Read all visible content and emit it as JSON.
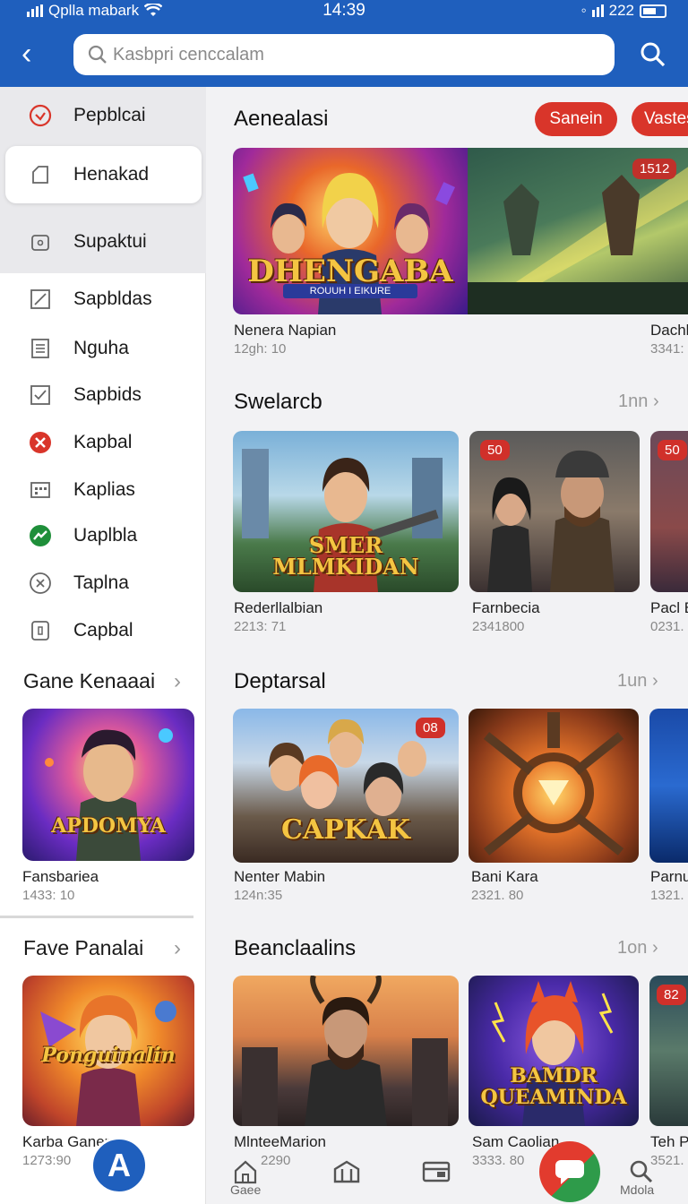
{
  "status": {
    "carrier": "Qplla mabark",
    "time": "14:39",
    "battery": "222"
  },
  "header": {
    "search_placeholder": "Kasbpri cenccalam"
  },
  "sidebar": {
    "top_items": [
      {
        "label": "Pepblcai",
        "icon": "check-circle-icon"
      },
      {
        "label": "Henakad",
        "icon": "cube-icon"
      },
      {
        "label": "Supaktui",
        "icon": "box-icon"
      }
    ],
    "items": [
      {
        "label": "Sapbldas",
        "icon": "slash-square-icon"
      },
      {
        "label": "Nguha",
        "icon": "list-icon"
      },
      {
        "label": "Sapbids",
        "icon": "check-square-icon"
      },
      {
        "label": "Kapbal",
        "icon": "red-x-icon"
      },
      {
        "label": "Kaplias",
        "icon": "grid-icon"
      },
      {
        "label": "Uaplbla",
        "icon": "trend-icon"
      },
      {
        "label": "Taplna",
        "icon": "close-circle-icon"
      },
      {
        "label": "Capbal",
        "icon": "info-square-icon"
      }
    ],
    "section1": {
      "title": "Gane Kenaaai",
      "card": {
        "art": "APDOMYA",
        "title": "Fansbariea",
        "sub": "1433: 10"
      }
    },
    "section2": {
      "title": "Fave Panalai",
      "card": {
        "art": "Ponguinalin",
        "title": "Karba Ganep",
        "sub": "1273:90"
      }
    }
  },
  "main": {
    "featured": {
      "title": "Aenealasi",
      "pills": [
        "Sanein",
        "Vastes"
      ],
      "banner_left_art": "DHENGABA",
      "banner_left_sub": "ROUUH I EIKURE",
      "banner_badge": "1512",
      "items": [
        {
          "title": "Nenera Napian",
          "sub": "12gh: 10"
        },
        {
          "title": "Dachl",
          "sub": "3341:"
        }
      ]
    },
    "sections": [
      {
        "title": "Swelarcb",
        "more": "1nn",
        "tiles": [
          {
            "art": "SMER MLMKIDAN",
            "badge": "",
            "title": "Rederllalbian",
            "sub": "2213: 71"
          },
          {
            "art": "",
            "badge": "50",
            "title": "Farnbecia",
            "sub": "2341800"
          },
          {
            "art": "",
            "badge": "50",
            "title": "Pacl B",
            "sub": "0231."
          }
        ]
      },
      {
        "title": "Deptarsal",
        "more": "1un",
        "tiles": [
          {
            "art": "CAPKAK",
            "badge": "08",
            "title": "Nenter Mabin",
            "sub": "124n:35"
          },
          {
            "art": "",
            "badge": "",
            "title": "Bani Kara",
            "sub": "2321. 80"
          },
          {
            "art": "",
            "badge": "",
            "title": "Parnu",
            "sub": "1321."
          }
        ]
      },
      {
        "title": "Beanclaalins",
        "more": "1on",
        "tiles": [
          {
            "art": "",
            "badge": "",
            "title": "MlnteeMarion",
            "sub": "2290"
          },
          {
            "art": "BAMDR QUEAMINDA",
            "badge": "",
            "title": "Sam Caolian",
            "sub": "3333. 80"
          },
          {
            "art": "",
            "badge": "82",
            "title": "Teh P",
            "sub": "3521."
          }
        ]
      }
    ]
  },
  "bottomnav": {
    "home_label": "Gaee",
    "search_label": "Mdola",
    "fab_letter": "A"
  }
}
